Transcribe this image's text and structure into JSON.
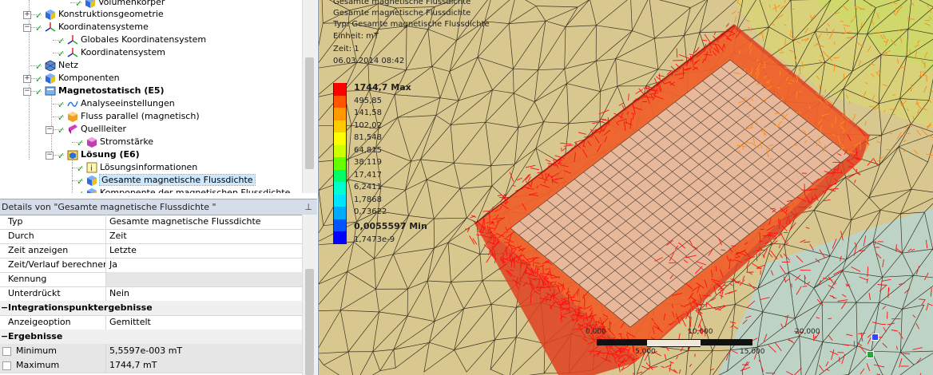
{
  "tree": {
    "items": [
      {
        "label": "Volumenkörper"
      },
      {
        "label": "Konstruktionsgeometrie"
      },
      {
        "label": "Koordinatensysteme"
      },
      {
        "label": "Globales Koordinatensystem"
      },
      {
        "label": "Koordinatensystem"
      },
      {
        "label": "Netz"
      },
      {
        "label": "Komponenten"
      },
      {
        "label": "Magnetostatisch (E5)"
      },
      {
        "label": "Analyseeinstellungen"
      },
      {
        "label": "Fluss parallel (magnetisch)"
      },
      {
        "label": "Quellleiter"
      },
      {
        "label": "Stromstärke"
      },
      {
        "label": "Lösung (E6)"
      },
      {
        "label": "Lösungsinformationen"
      },
      {
        "label": "Gesamte magnetische Flussdichte"
      },
      {
        "label": "Komponente der magnetischen Flussdichte"
      }
    ]
  },
  "details": {
    "title": "Details von \"Gesamte magnetische Flussdichte \"",
    "pin": "ⱼ",
    "rows": [
      {
        "key": "Typ",
        "value": "Gesamte magnetische Flussdichte"
      },
      {
        "key": "Durch",
        "value": "Zeit"
      },
      {
        "key": "Zeit anzeigen",
        "value": "Letzte"
      },
      {
        "key": "Zeit/Verlauf berechnen",
        "value": "Ja"
      },
      {
        "key": "Kennung",
        "value": ""
      },
      {
        "key": "Unterdrückt",
        "value": "Nein"
      }
    ],
    "group1": "Integrationspunktergebnisse",
    "row_anzeige": {
      "key": "Anzeigeoption",
      "value": "Gemittelt"
    },
    "group2": "Ergebnisse",
    "row_min": {
      "key": "Minimum",
      "value": "5,5597e-003 mT"
    },
    "row_max": {
      "key": "Maximum",
      "value": "1744,7 mT"
    },
    "minus": "−"
  },
  "viewport": {
    "header_lines": [
      "Gesamte magnetische Flussdichte",
      "Typ: Gesamte magnetische Flussdichte",
      "Einheit: mT",
      "Zeit: 1",
      "06.03.2014 08:42"
    ],
    "legend": {
      "max_label": "1744,7 Max",
      "values": [
        "495,85",
        "141,58",
        "102,02",
        "81,548",
        "64,815",
        "38,119",
        "17,417",
        "6,2411",
        "1,7868",
        "0,73622"
      ],
      "min_label": "0,0055597 Min",
      "last": "1,7473e-9",
      "colors": [
        "#ff0000",
        "#ff5500",
        "#ff9900",
        "#ffcc00",
        "#ffff00",
        "#ccff00",
        "#66ff00",
        "#00ff66",
        "#00ffcc",
        "#00e5ff",
        "#00aaff",
        "#0055ff",
        "#0000ff"
      ]
    },
    "scale": {
      "l0": "0,000",
      "l1": "10,000",
      "l2": "20,000",
      "l3": "5,000",
      "l4": "15,000"
    },
    "colors": {
      "background": "#d8c78f",
      "hot": "#ff1a1a",
      "block": "#e8b79a"
    }
  }
}
